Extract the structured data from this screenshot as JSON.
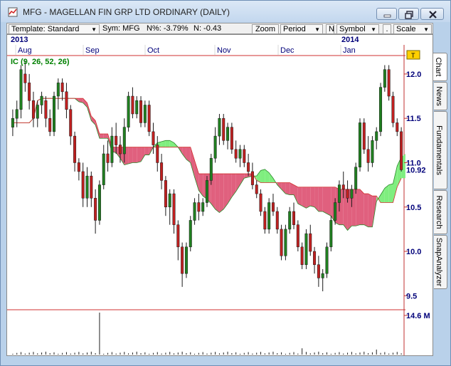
{
  "window": {
    "title": "MFG - MAGELLAN FIN GRP LTD  ORDINARY (DAILY)",
    "app_icon": "omnitrader-icon",
    "controls": [
      "minimize-icon",
      "maximize-icon",
      "close-icon"
    ]
  },
  "toolbar": {
    "template_label": "Template: Standard",
    "sym_label": "Sym: MFG",
    "npct_label": "N%: -3.79%",
    "nchange_label": "N: -0.43",
    "zoom_label": "Zoom",
    "period_label": "Period",
    "n_label": "N",
    "symbol_label": "Symbol",
    "dot_label": ".",
    "scale_label": "Scale"
  },
  "side_tabs": [
    "Chart",
    "News",
    "Fundamentals",
    "Research",
    "SnapAnalyzer"
  ],
  "active_tab": "Chart",
  "colors": {
    "up_cloud": "#7fee7f",
    "down_cloud": "#e0607e",
    "baseline": "#d23030",
    "candle": "#208020",
    "indicator_label": "#008000",
    "axis_text": "#00007a"
  },
  "chart_data": {
    "type": "candlestick",
    "symbol": "MFG",
    "indicator_label": "IC (9, 26, 52, 26)",
    "years": [
      "2013",
      "2014"
    ],
    "months": [
      "Aug",
      "Sep",
      "Oct",
      "Nov",
      "Dec",
      "Jan"
    ],
    "price_ticks": [
      "12.0",
      "11.5",
      "11.0",
      "10.5",
      "10.0",
      "9.5"
    ],
    "ylim": [
      9.35,
      12.2
    ],
    "last_price": "10.92",
    "volume_label": "14.6 M",
    "latest_marker": "T",
    "candles": [
      [
        11.4,
        11.6,
        11.3,
        11.5
      ],
      [
        11.5,
        11.7,
        11.4,
        11.6
      ],
      [
        11.6,
        12.1,
        11.5,
        12.05
      ],
      [
        12.0,
        12.15,
        11.8,
        11.9
      ],
      [
        11.9,
        12.0,
        11.6,
        11.7
      ],
      [
        11.7,
        11.8,
        11.4,
        11.5
      ],
      [
        11.5,
        11.7,
        11.4,
        11.65
      ],
      [
        11.65,
        11.8,
        11.55,
        11.75
      ],
      [
        11.7,
        11.75,
        11.4,
        11.5
      ],
      [
        11.5,
        11.6,
        11.3,
        11.35
      ],
      [
        11.35,
        11.8,
        11.3,
        11.75
      ],
      [
        11.75,
        11.95,
        11.6,
        11.9
      ],
      [
        11.9,
        11.95,
        11.7,
        11.8
      ],
      [
        11.8,
        11.9,
        11.5,
        11.6
      ],
      [
        11.6,
        11.65,
        11.2,
        11.3
      ],
      [
        11.3,
        11.35,
        10.9,
        11.0
      ],
      [
        11.0,
        11.05,
        10.8,
        10.9
      ],
      [
        10.9,
        11.0,
        10.5,
        10.6
      ],
      [
        10.6,
        10.95,
        10.5,
        10.85
      ],
      [
        10.85,
        10.9,
        10.5,
        10.6
      ],
      [
        10.6,
        10.7,
        10.2,
        10.35
      ],
      [
        10.35,
        10.8,
        10.3,
        10.75
      ],
      [
        10.75,
        11.2,
        10.7,
        11.1
      ],
      [
        11.1,
        11.25,
        10.9,
        11.0
      ],
      [
        11.0,
        11.4,
        10.95,
        11.3
      ],
      [
        11.3,
        11.45,
        11.1,
        11.2
      ],
      [
        11.2,
        11.3,
        11.0,
        11.1
      ],
      [
        11.1,
        11.5,
        11.0,
        11.4
      ],
      [
        11.4,
        11.8,
        11.35,
        11.75
      ],
      [
        11.75,
        11.85,
        11.5,
        11.55
      ],
      [
        11.55,
        11.75,
        11.5,
        11.7
      ],
      [
        11.7,
        11.75,
        11.4,
        11.45
      ],
      [
        11.45,
        11.7,
        11.4,
        11.65
      ],
      [
        11.65,
        11.7,
        11.3,
        11.35
      ],
      [
        11.35,
        11.45,
        11.1,
        11.2
      ],
      [
        11.2,
        11.3,
        10.9,
        11.0
      ],
      [
        11.0,
        11.1,
        10.7,
        10.8
      ],
      [
        10.8,
        10.85,
        10.4,
        10.5
      ],
      [
        10.5,
        10.7,
        10.3,
        10.65
      ],
      [
        10.65,
        10.7,
        10.2,
        10.3
      ],
      [
        10.3,
        10.35,
        9.9,
        10.05
      ],
      [
        10.05,
        10.1,
        9.6,
        9.75
      ],
      [
        9.75,
        10.1,
        9.7,
        10.05
      ],
      [
        10.05,
        10.4,
        10.0,
        10.35
      ],
      [
        10.35,
        10.6,
        10.3,
        10.55
      ],
      [
        10.55,
        10.65,
        10.35,
        10.45
      ],
      [
        10.45,
        10.6,
        10.4,
        10.55
      ],
      [
        10.55,
        10.85,
        10.5,
        10.8
      ],
      [
        10.8,
        11.1,
        10.75,
        11.05
      ],
      [
        11.05,
        11.4,
        11.0,
        11.3
      ],
      [
        11.3,
        11.55,
        11.2,
        11.5
      ],
      [
        11.5,
        11.55,
        11.2,
        11.25
      ],
      [
        11.25,
        11.45,
        11.15,
        11.4
      ],
      [
        11.4,
        11.45,
        11.1,
        11.15
      ],
      [
        11.15,
        11.25,
        11.0,
        11.05
      ],
      [
        11.05,
        11.2,
        10.95,
        11.15
      ],
      [
        11.15,
        11.2,
        10.95,
        11.0
      ],
      [
        11.0,
        11.1,
        10.85,
        10.9
      ],
      [
        10.9,
        11.0,
        10.7,
        10.75
      ],
      [
        10.75,
        10.8,
        10.6,
        10.65
      ],
      [
        10.65,
        10.7,
        10.4,
        10.45
      ],
      [
        10.45,
        10.5,
        10.2,
        10.25
      ],
      [
        10.25,
        10.6,
        10.2,
        10.55
      ],
      [
        10.55,
        10.65,
        10.4,
        10.45
      ],
      [
        10.45,
        10.5,
        10.2,
        10.25
      ],
      [
        10.25,
        10.3,
        9.9,
        9.95
      ],
      [
        9.95,
        10.3,
        9.9,
        10.25
      ],
      [
        10.25,
        10.5,
        10.2,
        10.45
      ],
      [
        10.45,
        10.55,
        10.25,
        10.3
      ],
      [
        10.3,
        10.35,
        10.0,
        10.05
      ],
      [
        10.05,
        10.1,
        9.8,
        9.85
      ],
      [
        9.85,
        10.25,
        9.8,
        10.2
      ],
      [
        10.2,
        10.3,
        9.95,
        10.0
      ],
      [
        10.0,
        10.05,
        9.75,
        9.85
      ],
      [
        9.85,
        9.95,
        9.6,
        9.7
      ],
      [
        9.7,
        9.8,
        9.55,
        9.75
      ],
      [
        9.75,
        10.1,
        9.7,
        10.05
      ],
      [
        10.05,
        10.4,
        10.0,
        10.35
      ],
      [
        10.35,
        10.6,
        10.3,
        10.55
      ],
      [
        10.55,
        10.8,
        10.45,
        10.75
      ],
      [
        10.75,
        10.9,
        10.6,
        10.7
      ],
      [
        10.7,
        10.8,
        10.55,
        10.6
      ],
      [
        10.6,
        10.75,
        10.5,
        10.7
      ],
      [
        10.7,
        11.0,
        10.65,
        10.95
      ],
      [
        10.95,
        11.5,
        10.9,
        11.45
      ],
      [
        11.45,
        11.5,
        11.1,
        11.15
      ],
      [
        11.15,
        11.3,
        10.9,
        11.0
      ],
      [
        11.0,
        11.3,
        10.95,
        11.25
      ],
      [
        11.25,
        11.4,
        11.15,
        11.35
      ],
      [
        11.35,
        11.9,
        11.3,
        11.85
      ],
      [
        11.85,
        12.1,
        11.8,
        12.05
      ],
      [
        12.05,
        12.1,
        11.7,
        11.75
      ],
      [
        11.75,
        11.8,
        11.4,
        11.45
      ],
      [
        11.45,
        11.5,
        11.3,
        11.35
      ],
      [
        11.35,
        11.4,
        10.9,
        10.92
      ]
    ]
  }
}
